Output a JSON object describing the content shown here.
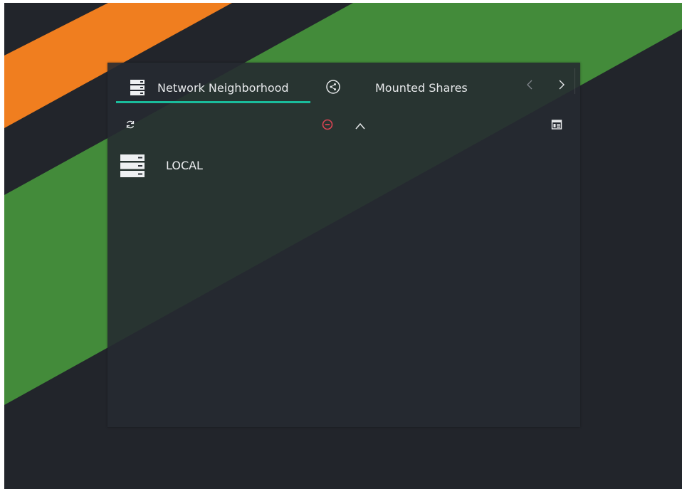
{
  "tabs": [
    {
      "label": "Network Neighborhood",
      "icon": "server-icon",
      "active": true
    },
    {
      "label": "Mounted Shares",
      "icon": "share-icon",
      "active": false
    }
  ],
  "tab_nav": {
    "prev_icon": "chevron-left-icon",
    "next_icon": "chevron-right-icon"
  },
  "toolbar": {
    "refresh_icon": "refresh-icon",
    "abort_icon": "stop-icon",
    "up_icon": "chevron-up-icon",
    "view_icon": "view-details-icon"
  },
  "items": [
    {
      "label": "LOCAL",
      "icon": "workgroup-server-icon"
    }
  ],
  "colors": {
    "accent": "#1abc9c",
    "abort": "#da4453",
    "background": "#22252b",
    "wallpaper_orange": "#f07e1f",
    "wallpaper_green": "#438b3a"
  }
}
